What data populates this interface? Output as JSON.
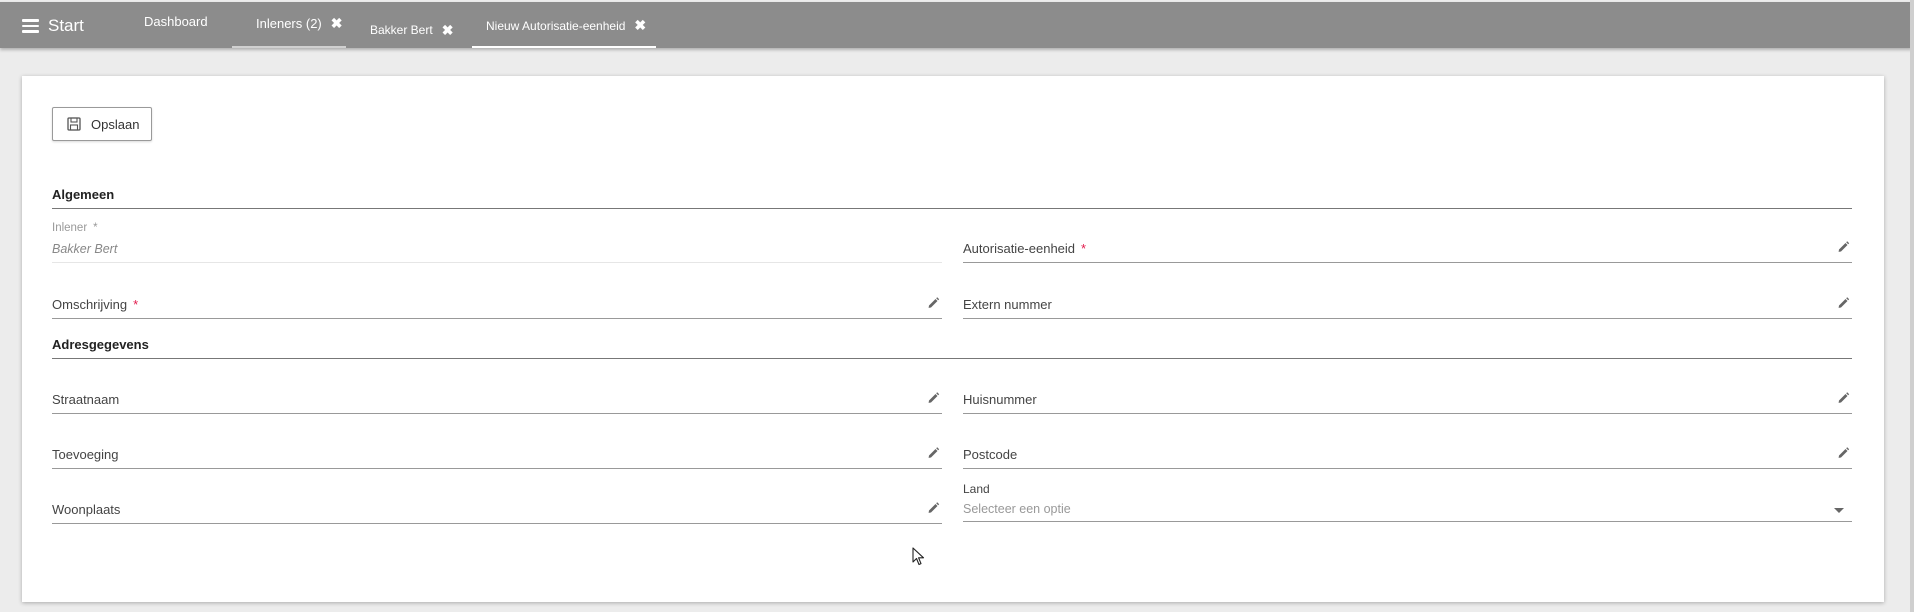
{
  "topbar": {
    "start_label": "Start",
    "tabs": [
      {
        "label": "Dashboard",
        "closable": false
      },
      {
        "label": "Inleners (2)",
        "closable": true
      },
      {
        "label": "Bakker Bert",
        "closable": true
      },
      {
        "label": "Nieuw Autorisatie-eenheid",
        "closable": true
      }
    ],
    "close_glyph": "✖"
  },
  "toolbar": {
    "save_label": "Opslaan"
  },
  "sections": {
    "general": "Algemeen",
    "address": "Adresgegevens"
  },
  "form": {
    "inlener": {
      "label": "Inlener",
      "required": "*",
      "value": "Bakker Bert"
    },
    "required_marker": "*",
    "autorisatie": {
      "label": "Autorisatie-eenheid"
    },
    "omschrijving": {
      "label": "Omschrijving"
    },
    "extern_nummer": {
      "label": "Extern nummer"
    },
    "straatnaam": {
      "label": "Straatnaam"
    },
    "huisnummer": {
      "label": "Huisnummer"
    },
    "toevoeging": {
      "label": "Toevoeging"
    },
    "postcode": {
      "label": "Postcode"
    },
    "woonplaats": {
      "label": "Woonplaats"
    },
    "land": {
      "label": "Land",
      "placeholder": "Selecteer een optie"
    }
  },
  "colors": {
    "topbar": "#8c8c8c",
    "required": "#e21b4c",
    "page_bg": "#ececec"
  },
  "icons": [
    "menu-icon",
    "close-icon",
    "save-icon",
    "pencil-icon",
    "chevron-down-icon",
    "mouse-cursor-icon"
  ]
}
